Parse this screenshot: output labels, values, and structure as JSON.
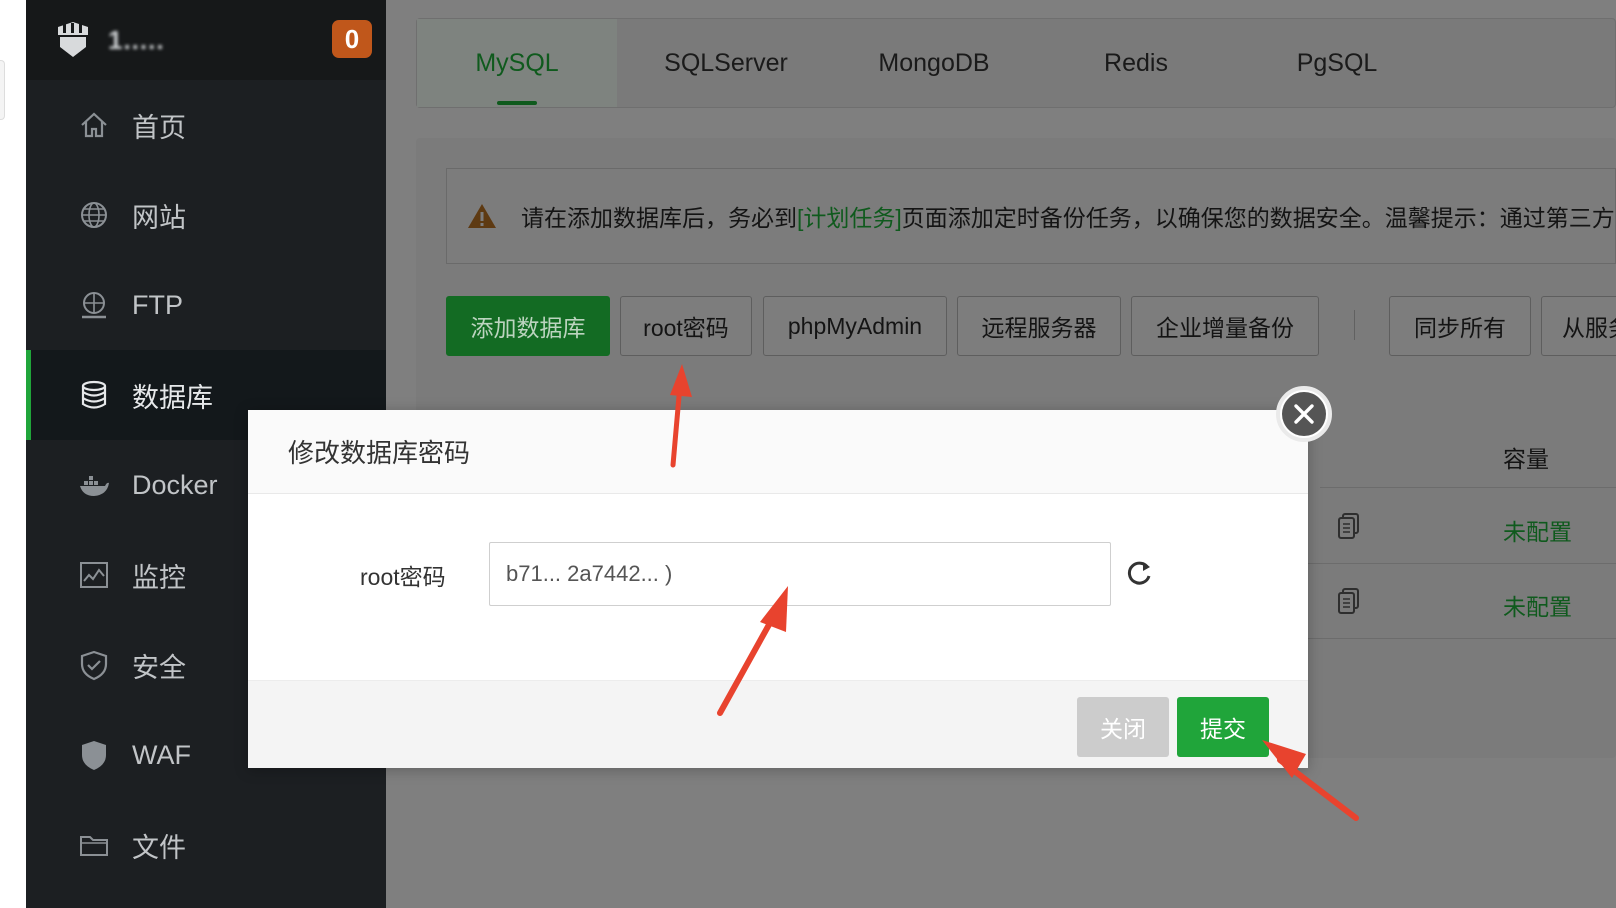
{
  "sidebar": {
    "server_name": "1.....",
    "badge_count": "0",
    "items": [
      {
        "label": "首页",
        "icon": "home-icon"
      },
      {
        "label": "网站",
        "icon": "globe-icon"
      },
      {
        "label": "FTP",
        "icon": "ftp-icon"
      },
      {
        "label": "数据库",
        "icon": "database-icon",
        "active": true
      },
      {
        "label": "Docker",
        "icon": "docker-icon"
      },
      {
        "label": "监控",
        "icon": "monitor-icon"
      },
      {
        "label": "安全",
        "icon": "shield-icon"
      },
      {
        "label": "WAF",
        "icon": "waf-icon"
      },
      {
        "label": "文件",
        "icon": "folder-icon"
      }
    ]
  },
  "tabs": [
    {
      "label": "MySQL",
      "active": true
    },
    {
      "label": "SQLServer"
    },
    {
      "label": "MongoDB"
    },
    {
      "label": "Redis"
    },
    {
      "label": "PgSQL"
    }
  ],
  "notice": {
    "text_before": "请在添加数据库后，务必到",
    "link": "[计划任务]",
    "text_after": "页面添加定时备份任务，以确保您的数据安全。温馨提示：通过第三方"
  },
  "toolbar": {
    "add_database": "添加数据库",
    "root_password": "root密码",
    "phpmyadmin": "phpMyAdmin",
    "remote_server": "远程服务器",
    "incremental_backup": "企业增量备份",
    "sync_all": "同步所有",
    "from_server": "从服务器"
  },
  "table": {
    "capacity_header": "容量",
    "rows": [
      {
        "status": "未配置"
      },
      {
        "status": "未配置"
      }
    ]
  },
  "dialog": {
    "title": "修改数据库密码",
    "field_label": "root密码",
    "field_value": "b71... 2a7442... )",
    "close_label": "关闭",
    "submit_label": "提交"
  },
  "colors": {
    "accent_green": "#20a53a",
    "badge_orange": "#c0571b",
    "annotation_red": "#e8432e"
  }
}
